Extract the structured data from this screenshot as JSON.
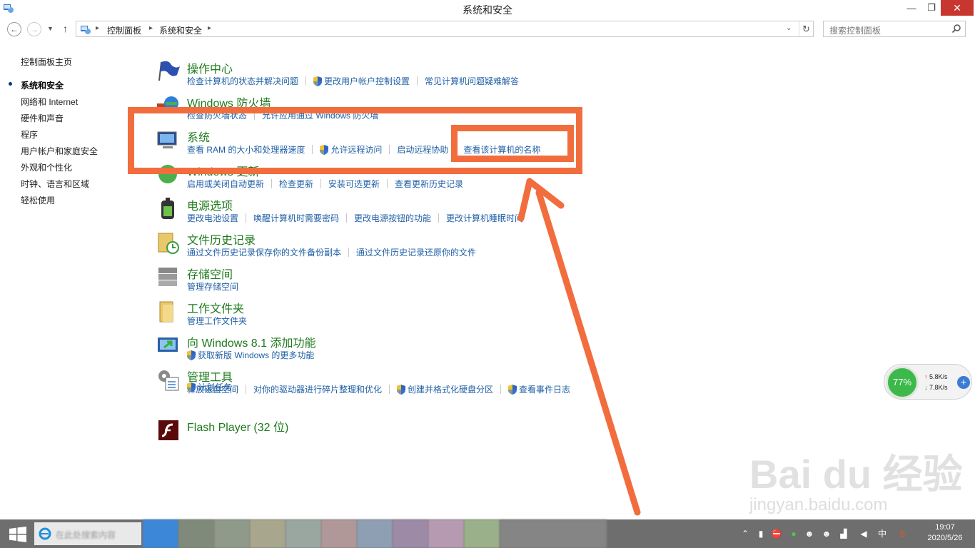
{
  "window": {
    "title": "系统和安全",
    "min_glyph": "—",
    "max_glyph": "❐",
    "close_glyph": "✕"
  },
  "nav": {
    "back": "←",
    "forward": "→",
    "recent": "▼",
    "up": "↑",
    "breadcrumb": [
      "控制面板",
      "系统和安全"
    ],
    "crumb_sep": "▸",
    "addr_dropdown": "⌄",
    "refresh": "↻"
  },
  "search": {
    "placeholder": "搜索控制面板"
  },
  "sidebar": {
    "items": [
      {
        "label": "控制面板主页",
        "current": false
      },
      {
        "label": "系统和安全",
        "current": true
      },
      {
        "label": "网络和 Internet",
        "current": false
      },
      {
        "label": "硬件和声音",
        "current": false
      },
      {
        "label": "程序",
        "current": false
      },
      {
        "label": "用户帐户和家庭安全",
        "current": false
      },
      {
        "label": "外观和个性化",
        "current": false
      },
      {
        "label": "时钟、语言和区域",
        "current": false
      },
      {
        "label": "轻松使用",
        "current": false
      }
    ]
  },
  "categories": [
    {
      "title": "操作中心",
      "icon": "flag-icon",
      "links": [
        {
          "label": "检查计算机的状态并解决问题",
          "shield": false
        },
        {
          "label": "更改用户帐户控制设置",
          "shield": true
        },
        {
          "label": "常见计算机问题疑难解答",
          "shield": false
        }
      ]
    },
    {
      "title": "Windows 防火墙",
      "icon": "firewall-icon",
      "links": [
        {
          "label": "检查防火墙状态",
          "shield": false
        },
        {
          "label": "允许应用通过 Windows 防火墙",
          "shield": false
        }
      ]
    },
    {
      "title": "系统",
      "icon": "system-icon",
      "links": [
        {
          "label": "查看 RAM 的大小和处理器速度",
          "shield": false
        },
        {
          "label": "允许远程访问",
          "shield": true
        },
        {
          "label": "启动远程协助",
          "shield": false
        },
        {
          "label": "查看该计算机的名称",
          "shield": false
        }
      ]
    },
    {
      "title": "Windows 更新",
      "icon": "windows-update-icon",
      "links": [
        {
          "label": "启用或关闭自动更新",
          "shield": false
        },
        {
          "label": "检查更新",
          "shield": false
        },
        {
          "label": "安装可选更新",
          "shield": false
        },
        {
          "label": "查看更新历史记录",
          "shield": false
        }
      ]
    },
    {
      "title": "电源选项",
      "icon": "power-options-icon",
      "links": [
        {
          "label": "更改电池设置",
          "shield": false
        },
        {
          "label": "唤醒计算机时需要密码",
          "shield": false
        },
        {
          "label": "更改电源按钮的功能",
          "shield": false
        },
        {
          "label": "更改计算机睡眠时间",
          "shield": false
        }
      ]
    },
    {
      "title": "文件历史记录",
      "icon": "file-history-icon",
      "links": [
        {
          "label": "通过文件历史记录保存你的文件备份副本",
          "shield": false
        },
        {
          "label": "通过文件历史记录还原你的文件",
          "shield": false
        }
      ]
    },
    {
      "title": "存储空间",
      "icon": "storage-spaces-icon",
      "links": [
        {
          "label": "管理存储空间",
          "shield": false
        }
      ]
    },
    {
      "title": "工作文件夹",
      "icon": "work-folders-icon",
      "links": [
        {
          "label": "管理工作文件夹",
          "shield": false
        }
      ]
    },
    {
      "title": "向 Windows 8.1 添加功能",
      "icon": "add-features-icon",
      "links": [
        {
          "label": "获取新版 Windows 的更多功能",
          "shield": true
        }
      ]
    },
    {
      "title": "管理工具",
      "icon": "admin-tools-icon",
      "links": [
        {
          "label": "释放磁盘空间",
          "shield": false
        },
        {
          "label": "对你的驱动器进行碎片整理和优化",
          "shield": false
        },
        {
          "label": "创建并格式化硬盘分区",
          "shield": true
        },
        {
          "label": "查看事件日志",
          "shield": true
        }
      ]
    },
    {
      "title": "",
      "icon": "",
      "links": [
        {
          "label": "计划任务",
          "shield": true
        }
      ]
    },
    {
      "title": "Flash Player (32 位)",
      "icon": "flash-player-icon",
      "links": []
    }
  ],
  "network_widget": {
    "percent": "77%",
    "up": "5.8K/s",
    "down": "7.8K/s",
    "plus": "+"
  },
  "watermark": {
    "text": "Bai du 经验",
    "sub": "jingyan.baidu.com"
  },
  "taskbar": {
    "search_text": "在此处搜索内容"
  },
  "clock": {
    "time": "19:07",
    "date": "2020/5/26"
  },
  "colors": {
    "annotation": "#f26d3d",
    "link": "#1f5fa5",
    "category_title": "#1e7a1e",
    "close": "#c7372f"
  }
}
